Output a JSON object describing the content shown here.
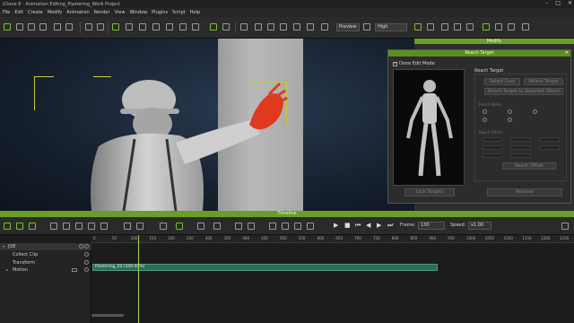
{
  "window": {
    "title": "iClone 8 - Animation Editing_Plastering_Work Project",
    "minimize": "–",
    "maximize": "□",
    "close": "✕"
  },
  "menu": [
    "File",
    "Edit",
    "Create",
    "Modify",
    "Animation",
    "Render",
    "View",
    "Window",
    "Plugins",
    "Script",
    "Help"
  ],
  "toolbar": {
    "view_mode": "Preview",
    "quality": "High"
  },
  "modify_panel": {
    "title": "Modify"
  },
  "reach_target": {
    "title": "Reach Target",
    "close": "✕",
    "done_edit_mode": "Done Edit Mode",
    "done_edit_checked": true,
    "section_label": "Reach Target",
    "left_buttons": [
      "Lock Targets"
    ],
    "disabled_buttons": [
      "Select Goal",
      "Attach Target",
      "Attach Target to Selected Object"
    ],
    "bottom_button": "Release",
    "offset_label": "Reach Offset",
    "blend_label": "Reach Mode",
    "apply_button": "Reach Offset"
  },
  "timeline": {
    "title": "Timeline",
    "frame_label": "Frame:",
    "frame_value": "130",
    "speed_label": "Speed:",
    "speed_value": "x1.00",
    "ruler_ticks": [
      "0",
      "50",
      "100",
      "150",
      "200",
      "250",
      "300",
      "350",
      "400",
      "450",
      "500",
      "550",
      "600",
      "650",
      "700",
      "750",
      "800",
      "850",
      "900",
      "950",
      "1000",
      "1050",
      "1100",
      "1150",
      "1200",
      "1250"
    ],
    "tracks": [
      {
        "label": "JOE"
      },
      {
        "label": "Collect Clip"
      },
      {
        "label": "Transform"
      },
      {
        "label": "Motion"
      }
    ],
    "clip_label": "Plastering_02 (100.00%)"
  }
}
